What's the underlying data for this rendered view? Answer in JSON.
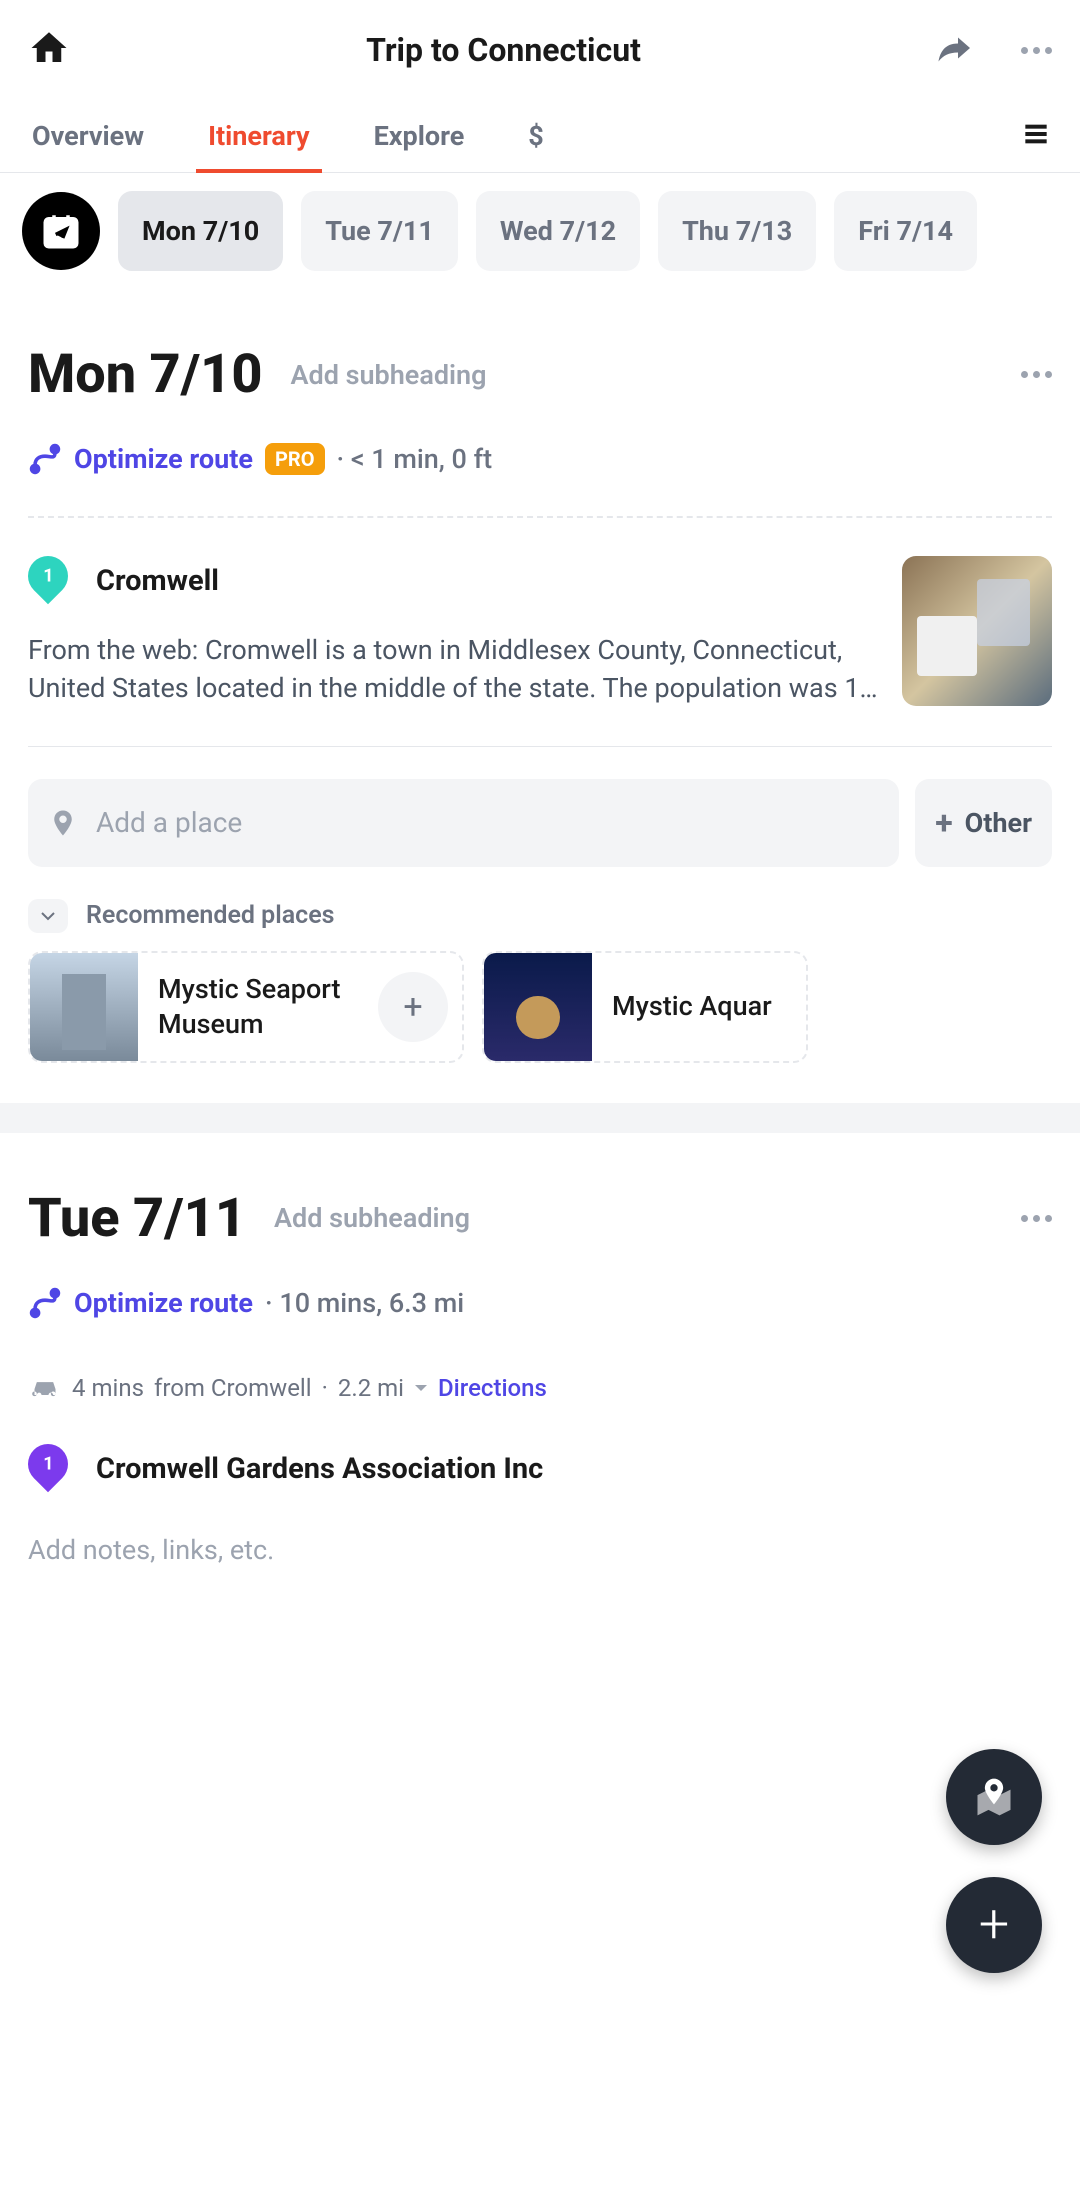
{
  "header": {
    "title": "Trip to Connecticut"
  },
  "tabs": {
    "overview": "Overview",
    "itinerary": "Itinerary",
    "explore": "Explore",
    "dollar": "$"
  },
  "dates": [
    "Mon 7/10",
    "Tue 7/11",
    "Wed 7/12",
    "Thu 7/13",
    "Fri 7/14"
  ],
  "day1": {
    "title": "Mon 7/10",
    "subheading": "Add subheading",
    "optimize": "Optimize route",
    "pro": "PRO",
    "time": "· < 1 min, 0 ft",
    "place1": {
      "pin": "1",
      "name": "Cromwell",
      "desc": "From the web: Cromwell is a town in Middlesex County, Connecticut, United States located in the middle of the state. The population was 1…"
    },
    "addPlace": "Add a place",
    "other": "Other",
    "recLabel": "Recommended places",
    "rec1": "Mystic Seaport Museum",
    "rec2": "Mystic Aquar"
  },
  "day2": {
    "title": "Tue 7/11",
    "subheading": "Add subheading",
    "optimize": "Optimize route",
    "time": "· 10 mins, 6.3 mi",
    "dirTime": "4 mins",
    "dirFrom": "from Cromwell",
    "dirDist": "2.2 mi",
    "dirLink": "Directions",
    "place1": {
      "pin": "1",
      "name": "Cromwell Gardens Association Inc"
    },
    "notes": "Add notes, links, etc."
  }
}
